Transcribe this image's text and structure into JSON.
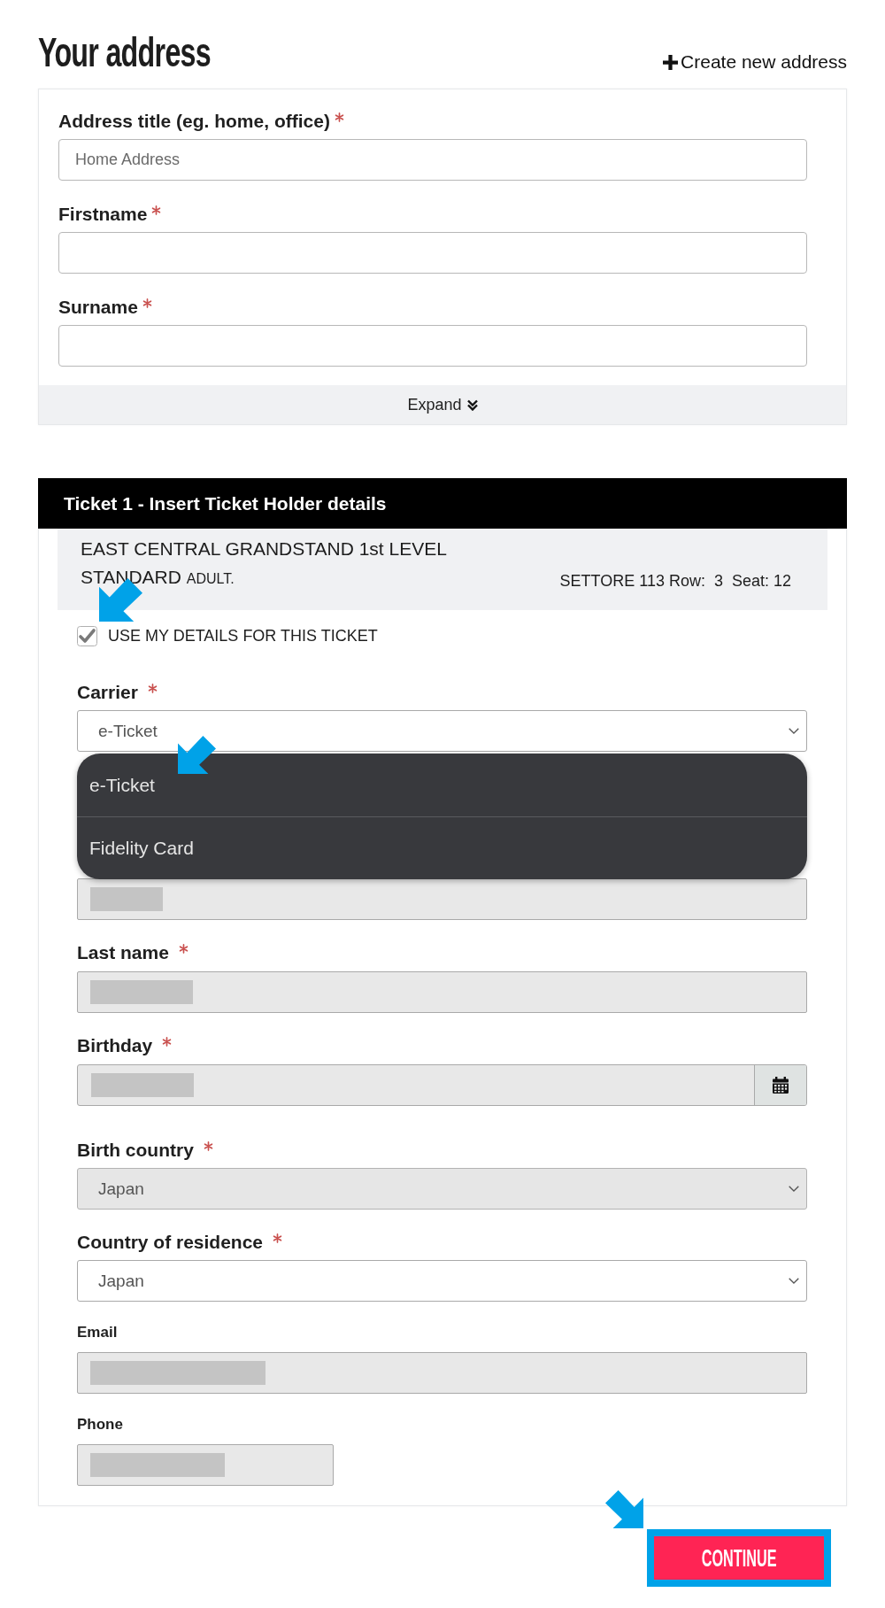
{
  "address": {
    "title": "Your address",
    "create_link": "Create new address",
    "fields": [
      {
        "label": "Address title (eg. home, office)",
        "required": true,
        "placeholder": "Home Address"
      },
      {
        "label": "Firstname",
        "required": true
      },
      {
        "label": "Surname",
        "required": true
      }
    ],
    "expand_button": "Expand"
  },
  "ticket": {
    "header": "Ticket 1 - Insert Ticket Holder details",
    "seat_description": "EAST CENTRAL GRANDSTAND 1st LEVEL STANDARD",
    "ticket_type": "ADULT.",
    "seat_location": "SETTORE 113 Row:  3  Seat: 12",
    "use_my_details": {
      "label": "USE MY DETAILS FOR THIS TICKET",
      "checked": true
    },
    "carrier": {
      "label": "Carrier",
      "required": true,
      "value": "e-Ticket",
      "expanded": true,
      "options": [
        "e-Ticket",
        "Fidelity Card"
      ]
    },
    "fields": [
      {
        "kind": "text",
        "disabled": true,
        "redacted": true
      },
      {
        "kind": "text",
        "label": "Last name",
        "required": true,
        "disabled": true,
        "redacted": true
      },
      {
        "kind": "date",
        "label": "Birthday",
        "required": true,
        "disabled": true,
        "redacted": true
      },
      {
        "kind": "select",
        "label": "Birth country",
        "required": true,
        "disabled": true,
        "value": "Japan"
      },
      {
        "kind": "select",
        "label": "Country of residence",
        "required": true,
        "disabled": false,
        "value": "Japan"
      },
      {
        "kind": "text",
        "label": "Email",
        "required": false,
        "disabled": true,
        "redacted": true
      },
      {
        "kind": "phone",
        "label": "Phone",
        "required": false,
        "disabled": true,
        "redacted": true
      }
    ]
  },
  "continue_button": "CONTINUE"
}
